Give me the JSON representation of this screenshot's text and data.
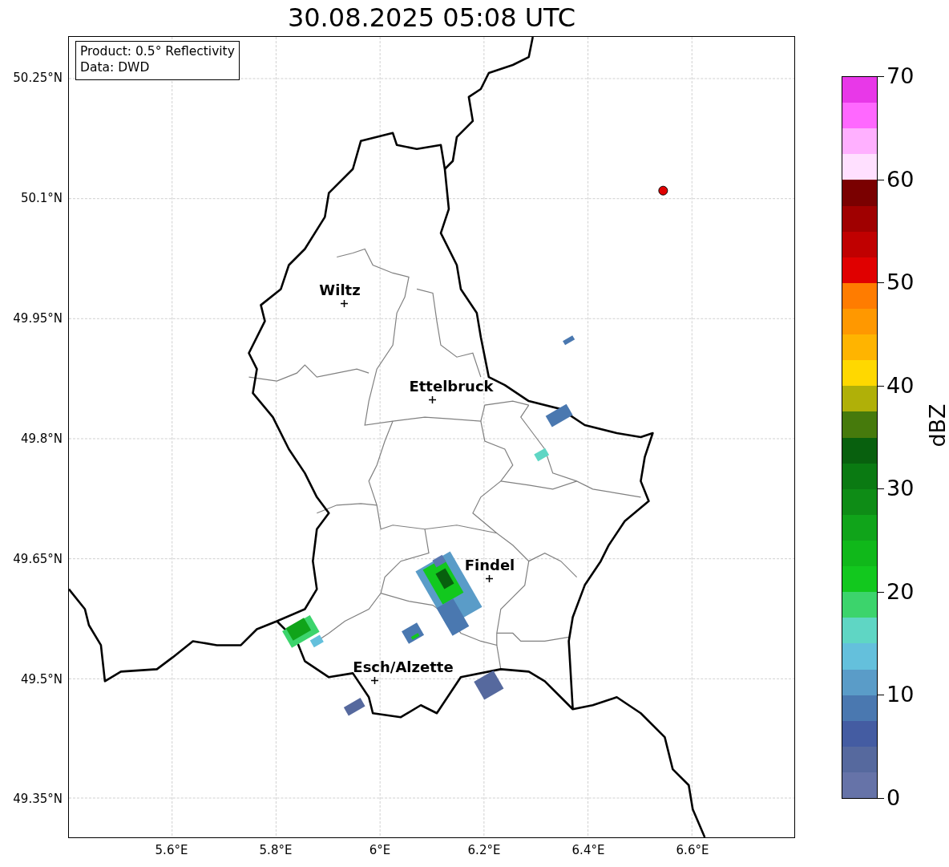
{
  "title": "30.08.2025 05:08 UTC",
  "info_box": [
    "Product: 0.5° Reflectivity",
    "Data: DWD"
  ],
  "lat_ticks": [
    "50.25°N",
    "50.1°N",
    "49.95°N",
    "49.8°N",
    "49.65°N",
    "49.5°N",
    "49.35°N"
  ],
  "lon_ticks": [
    "5.6°E",
    "5.8°E",
    "6°E",
    "6.2°E",
    "6.4°E",
    "6.6°E"
  ],
  "cities": [
    {
      "name": "Wiltz"
    },
    {
      "name": "Ettelbruck"
    },
    {
      "name": "Findel"
    },
    {
      "name": "Esch/Alzette"
    }
  ],
  "colorbar": {
    "label": "dBZ",
    "ticks": [
      "70",
      "60",
      "50",
      "40",
      "30",
      "20",
      "10",
      "0"
    ],
    "segments": [
      {
        "color": "#e838e8"
      },
      {
        "color": "#ff68ff"
      },
      {
        "color": "#ffb0ff"
      },
      {
        "color": "#ffe0ff"
      },
      {
        "color": "#7a0000"
      },
      {
        "color": "#a00000"
      },
      {
        "color": "#c00000"
      },
      {
        "color": "#e00000"
      },
      {
        "color": "#ff7c00"
      },
      {
        "color": "#ff9800"
      },
      {
        "color": "#ffb400"
      },
      {
        "color": "#ffd800"
      },
      {
        "color": "#b0b008"
      },
      {
        "color": "#467a0c"
      },
      {
        "color": "#08600e"
      },
      {
        "color": "#0a7a12"
      },
      {
        "color": "#0e8c16"
      },
      {
        "color": "#10a41a"
      },
      {
        "color": "#10b81a"
      },
      {
        "color": "#12c81e"
      },
      {
        "color": "#3cd46c"
      },
      {
        "color": "#5fd6c4"
      },
      {
        "color": "#64c0dc"
      },
      {
        "color": "#5a9cc8"
      },
      {
        "color": "#4a78b0"
      },
      {
        "color": "#445ca2"
      },
      {
        "color": "#56699e"
      },
      {
        "color": "#6673a8"
      }
    ]
  }
}
